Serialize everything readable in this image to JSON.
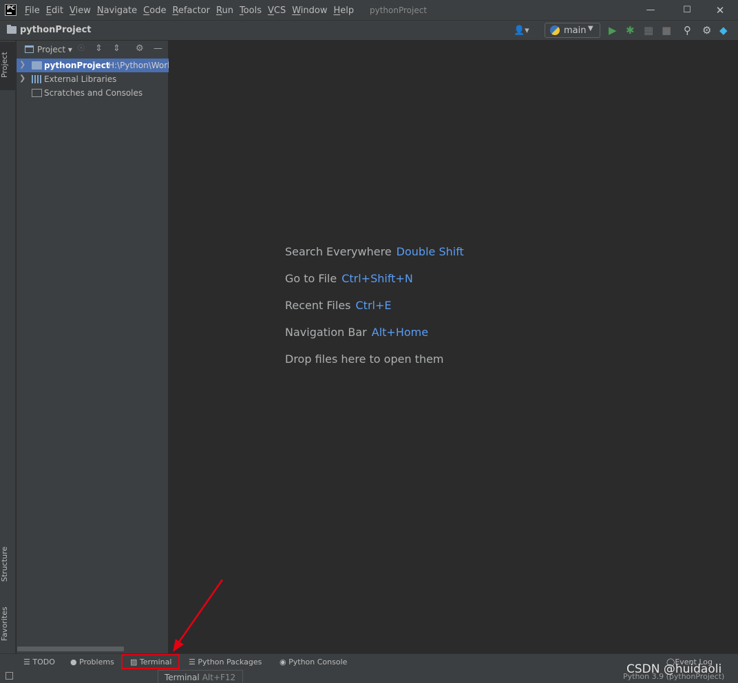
{
  "titlebar": {
    "logo_text": "PC",
    "menu": [
      "File",
      "Edit",
      "View",
      "Navigate",
      "Code",
      "Refactor",
      "Run",
      "Tools",
      "VCS",
      "Window",
      "Help"
    ],
    "window_title": "pythonProject"
  },
  "navbar": {
    "project_name": "pythonProject",
    "run_config": "main"
  },
  "left_stripe": {
    "project_tab": "Project",
    "structure_tab": "Structure",
    "favorites_tab": "Favorites"
  },
  "project_panel": {
    "title": "Project",
    "tree": [
      {
        "label": "pythonProject",
        "path": "H:\\Python\\Work",
        "selected": true
      },
      {
        "label": "External Libraries"
      },
      {
        "label": "Scratches and Consoles"
      }
    ]
  },
  "editor": {
    "hints": [
      {
        "label": "Search Everywhere",
        "key": "Double Shift"
      },
      {
        "label": "Go to File",
        "key": "Ctrl+Shift+N"
      },
      {
        "label": "Recent Files",
        "key": "Ctrl+E"
      },
      {
        "label": "Navigation Bar",
        "key": "Alt+Home"
      },
      {
        "label": "Drop files here to open them",
        "key": ""
      }
    ]
  },
  "bottom_bar": {
    "todo": "TODO",
    "problems": "Problems",
    "terminal": "Terminal",
    "python_packages": "Python Packages",
    "python_console": "Python Console",
    "event_log": "Event Log"
  },
  "tooltip": {
    "label": "Terminal",
    "shortcut": "Alt+F12"
  },
  "status": {
    "interpreter": "Python 3.9 (pythonProject)"
  },
  "watermark": "CSDN @huidaoli",
  "colors": {
    "accent": "#589df6",
    "selection": "#4b6eaf",
    "annotation_red": "#e60012"
  }
}
